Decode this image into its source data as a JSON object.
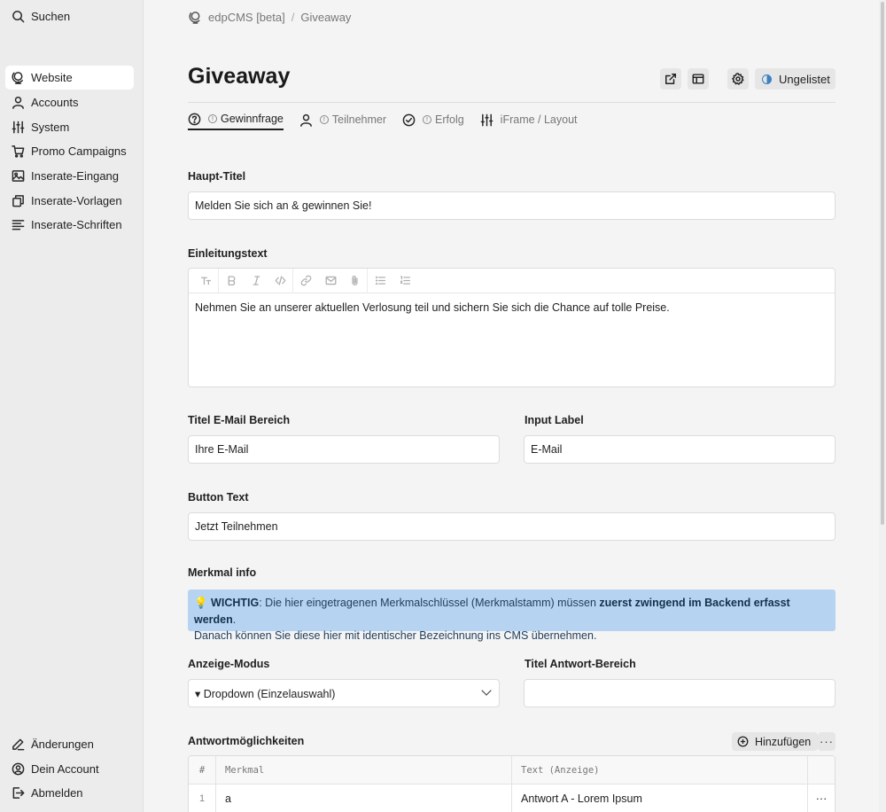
{
  "sidebar": {
    "search_label": "Suchen",
    "items": [
      {
        "label": "Website",
        "icon": "globe-icon"
      },
      {
        "label": "Accounts",
        "icon": "user-icon"
      },
      {
        "label": "System",
        "icon": "sliders-icon"
      },
      {
        "label": "Promo Campaigns",
        "icon": "cart-icon"
      },
      {
        "label": "Inserate-Eingang",
        "icon": "image-icon"
      },
      {
        "label": "Inserate-Vorlagen",
        "icon": "copy-icon"
      },
      {
        "label": "Inserate-Schriften",
        "icon": "text-lines-icon"
      }
    ],
    "bottom": [
      {
        "label": "Änderungen",
        "icon": "pencil-icon"
      },
      {
        "label": "Dein Account",
        "icon": "user-circle-icon"
      },
      {
        "label": "Abmelden",
        "icon": "logout-icon"
      }
    ]
  },
  "breadcrumb": {
    "root": "edpCMS [beta]",
    "separator": "/",
    "current": "Giveaway"
  },
  "page_title": "Giveaway",
  "header_actions": {
    "status_label": "Ungelistet"
  },
  "tabs": [
    {
      "label": "Gewinnfrage",
      "badge": "!"
    },
    {
      "label": "Teilnehmer",
      "badge": "!"
    },
    {
      "label": "Erfolg",
      "badge": "!"
    },
    {
      "label": "iFrame / Layout"
    }
  ],
  "form": {
    "haupt_titel_label": "Haupt-Titel",
    "haupt_titel_value": "Melden Sie sich an & gewinnen Sie!",
    "einleitung_label": "Einleitungstext",
    "einleitung_value": "Nehmen Sie an unserer aktuellen Verlosung teil und sichern Sie sich die Chance auf tolle Preise.",
    "email_titel_label": "Titel E-Mail Bereich",
    "email_titel_value": "Ihre E-Mail",
    "input_label_label": "Input Label",
    "input_label_value": "E-Mail",
    "button_text_label": "Button Text",
    "button_text_value": "Jetzt Teilnehmen",
    "merkmal_label": "Merkmal info",
    "info_prefix": "💡 ",
    "info_strong1": "WICHTIG",
    "info_text1": ": Die hier eingetragenen Merkmalschlüssel (Merkmalstamm) müssen ",
    "info_strong2": "zuerst zwingend im Backend erfasst werden",
    "info_text2": ".",
    "info_line2": "Danach können Sie diese hier mit identischer Bezeichnung ins CMS übernehmen.",
    "anzeige_label": "Anzeige-Modus",
    "anzeige_value": "▾ Dropdown (Einzelauswahl)",
    "antwort_titel_label": "Titel Antwort-Bereich",
    "antwort_titel_value": ""
  },
  "answers": {
    "label": "Antwortmöglichkeiten",
    "add_label": "Hinzufügen",
    "more_label": "···",
    "columns": [
      "#",
      "Merkmal",
      "Text (Anzeige)"
    ],
    "rows": [
      {
        "index": "1",
        "merkmal": "a",
        "text": "Antwort A - Lorem Ipsum",
        "more": "···"
      }
    ]
  },
  "toolbar_icons": [
    "text-size-icon",
    "bold-icon",
    "italic-icon",
    "code-icon",
    "link-icon",
    "mail-icon",
    "attachment-icon",
    "bullet-list-icon",
    "numbered-list-icon"
  ]
}
